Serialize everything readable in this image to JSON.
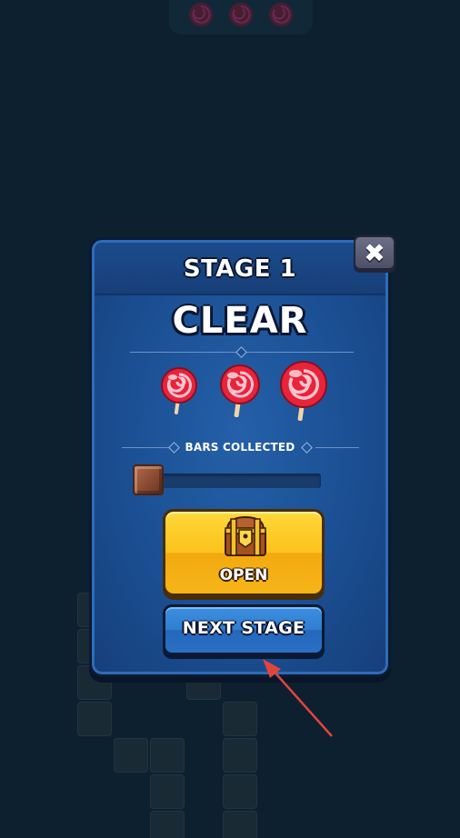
{
  "popup": {
    "title": "STAGE 1",
    "status": "CLEAR",
    "stars_earned": 3,
    "stars_total": 3,
    "bars_label": "BARS COLLECTED",
    "bars_progress": 0.1,
    "open_button_label": "OPEN",
    "next_button_label": "NEXT STAGE",
    "close_icon": "close-icon"
  },
  "colors": {
    "background": "#0d2030",
    "panel": "#1b4f93",
    "open_button": "#fbc21b",
    "next_button": "#2f7ed1",
    "close_button": "#5b5d75",
    "lollipop": "#e8233a",
    "annotation_arrow": "#e0453c"
  },
  "icons": {
    "reward": "lollipop-icon",
    "chest": "treasure-chest-icon",
    "bar": "chocolate-bar-icon"
  }
}
